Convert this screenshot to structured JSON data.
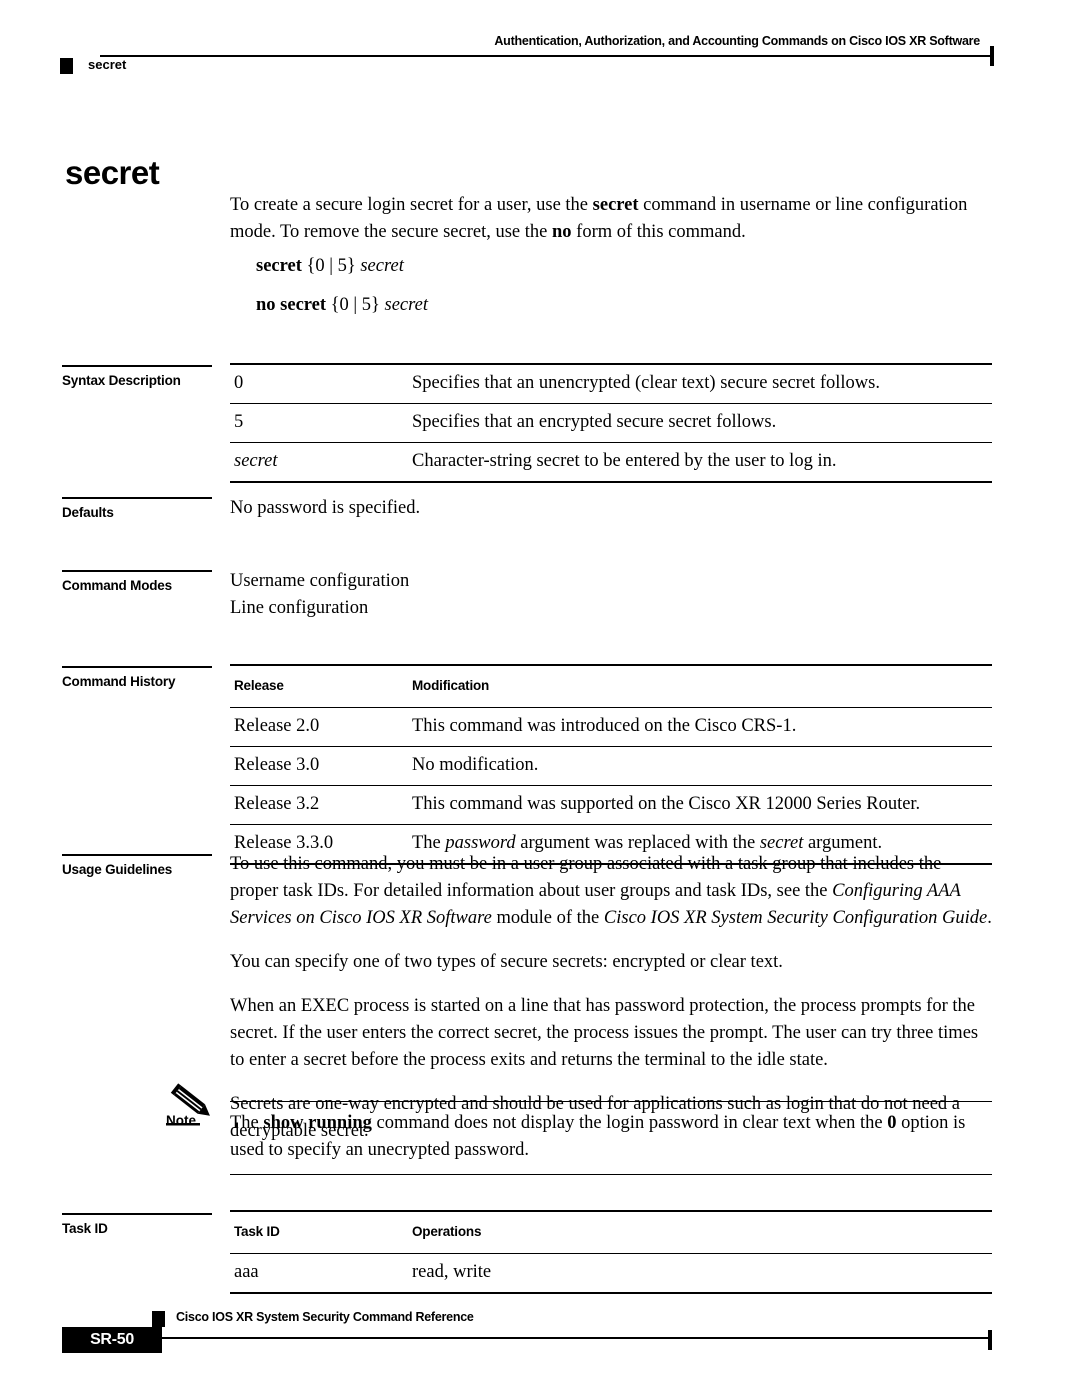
{
  "header": {
    "title": "Authentication, Authorization, and Accounting Commands on Cisco IOS XR Software",
    "command": "secret",
    "marker_icon": "black-square-marker"
  },
  "page_title": "secret",
  "intro": {
    "text_before_bold1": "To create a secure login secret for a user, use the ",
    "bold1": "secret",
    "text_mid": " command in username or line configuration mode. To remove the secure secret, use the ",
    "bold2": "no",
    "text_after": " form of this command."
  },
  "syntax_lines": [
    {
      "cmd": "secret",
      "brace": " {0 | 5} ",
      "arg": "secret"
    },
    {
      "cmd": "no secret",
      "brace": " {0 | 5} ",
      "arg": "secret"
    }
  ],
  "sections": {
    "syntax_description": {
      "label": "Syntax Description",
      "rows": [
        {
          "term": "0",
          "style": "bold",
          "desc": "Specifies that an unencrypted (clear text) secure secret follows."
        },
        {
          "term": "5",
          "style": "bold",
          "desc": "Specifies that an encrypted secure secret follows."
        },
        {
          "term": "secret",
          "style": "italic",
          "desc": "Character-string secret to be entered by the user to log in."
        }
      ]
    },
    "defaults": {
      "label": "Defaults",
      "text": "No password is specified."
    },
    "command_modes": {
      "label": "Command Modes",
      "lines": [
        "Username configuration",
        "Line configuration"
      ]
    },
    "command_history": {
      "label": "Command History",
      "columns": [
        "Release",
        "Modification"
      ],
      "rows": [
        {
          "release": "Release 2.0",
          "modification": "This command was introduced on the Cisco CRS-1."
        },
        {
          "release": "Release 3.0",
          "modification": "No modification."
        },
        {
          "release": "Release 3.2",
          "modification": "This command was supported on the Cisco XR 12000 Series Router."
        },
        {
          "release": "Release 3.3.0",
          "modification_pre": "The ",
          "modification_i1": "password",
          "modification_mid": " argument was replaced with the ",
          "modification_i2": "secret",
          "modification_post": " argument."
        }
      ]
    },
    "usage_guidelines": {
      "label": "Usage Guidelines",
      "p1_pre": "To use this command, you must be in a user group associated with a task group that includes the proper task IDs. For detailed information about user groups and task IDs, see the ",
      "p1_i1": "Configuring AAA Services on Cisco IOS XR Software",
      "p1_mid": " module of the ",
      "p1_i2": "Cisco IOS XR System Security Configuration Guide",
      "p1_post": ".",
      "p2": "You can specify one of two types of secure secrets: encrypted or clear text.",
      "p3": "When an EXEC process is started on a line that has password protection, the process prompts for the secret. If the user enters the correct secret, the process issues the prompt. The user can try three times to enter a secret before the process exits and returns the terminal to the idle state.",
      "p4": "Secrets are one-way encrypted and should be used for applications such as login that do not need a decryptable secret."
    },
    "note": {
      "label": "Note",
      "icon": "pencil-icon",
      "pre": "The ",
      "bold1": "show running",
      "mid": " command does not display the login password in clear text when the ",
      "bold2": "0",
      "post": " option is used to specify an unecrypted password."
    },
    "task_id": {
      "label": "Task ID",
      "columns": [
        "Task ID",
        "Operations"
      ],
      "rows": [
        {
          "task": "aaa",
          "operations": "read, write"
        }
      ]
    }
  },
  "footer": {
    "doc_title": "Cisco IOS XR System Security Command Reference",
    "page_number": "SR-50",
    "marker_icon": "black-square-marker"
  }
}
